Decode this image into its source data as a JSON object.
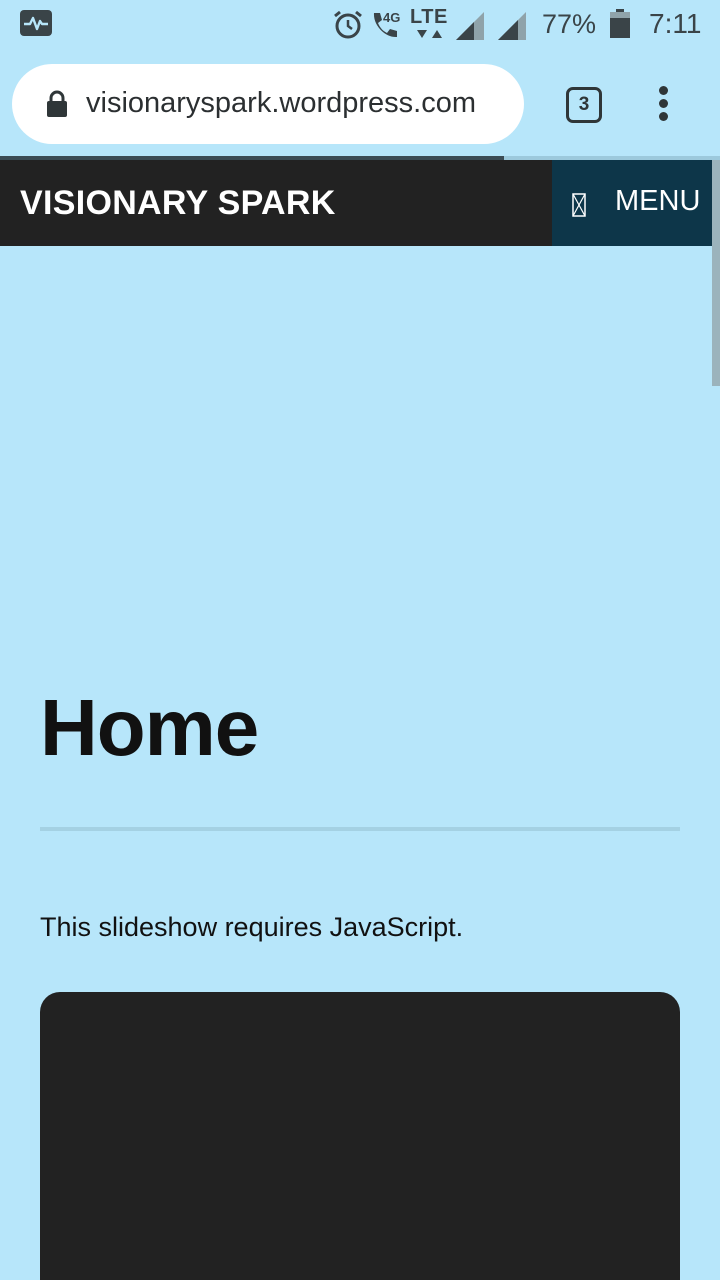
{
  "status_bar": {
    "network_4g": "4G",
    "network_lte": "LTE",
    "battery_percent": "77%",
    "time": "7:11",
    "icons": [
      "activity-icon",
      "alarm-icon",
      "wifi-call-icon",
      "signal-icon",
      "signal-icon",
      "battery-icon"
    ]
  },
  "browser": {
    "url": "visionaryspark.wordpress.com",
    "tab_count": "3",
    "load_progress": 0.7
  },
  "site": {
    "title": "VISIONARY SPARK",
    "menu_label": "MENU"
  },
  "page": {
    "title": "Home",
    "slideshow_notice": "This slideshow requires JavaScript."
  },
  "colors": {
    "page_background": "#b7e6fa",
    "header_background": "#222222",
    "menu_background": "#0d3649",
    "slideshow_background": "#222222"
  }
}
